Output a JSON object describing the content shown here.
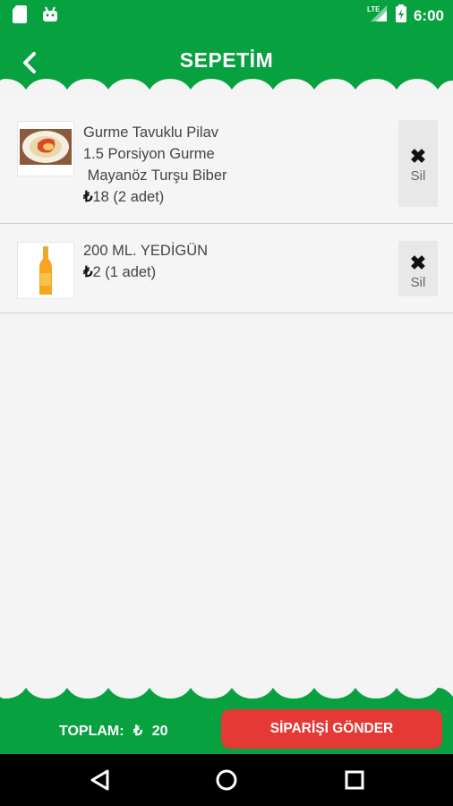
{
  "status_bar": {
    "time": "6:00",
    "network": "LTE"
  },
  "header": {
    "title": "SEPETİM"
  },
  "cart_items": [
    {
      "name": "Gurme Tavuklu Pilav",
      "detail_line1": "1.5 Porsiyon Gurme",
      "detail_line2": " Mayanöz Turşu Biber",
      "price": "18 (2 adet)",
      "delete_label": "Sil"
    },
    {
      "name": "200 ML. YEDİGÜN",
      "price": "2 (1 adet)",
      "delete_label": "Sil"
    }
  ],
  "footer": {
    "total_label": "TOPLAM:",
    "currency": "₺",
    "total_value": "20",
    "send_button": "SİPARİŞİ GÖNDER"
  },
  "colors": {
    "primary": "#07a13f",
    "send_button": "#e53935",
    "background": "#f4f4f4"
  }
}
